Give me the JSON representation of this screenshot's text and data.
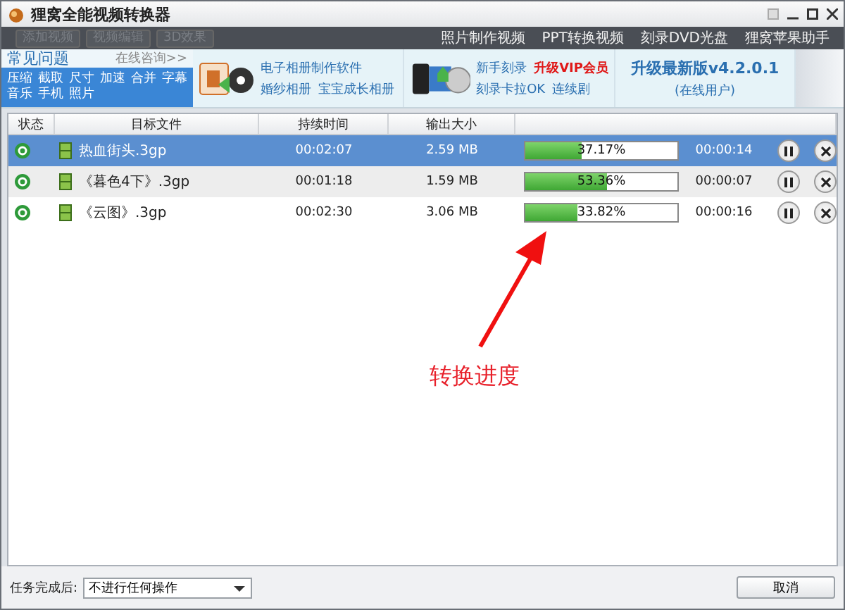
{
  "window": {
    "title": "狸窝全能视频转换器"
  },
  "toolbar": {
    "buttons": [
      {
        "label": "添加视频",
        "disabled": true
      },
      {
        "label": "视频编辑",
        "disabled": true
      },
      {
        "label": "3D效果",
        "disabled": true
      }
    ],
    "links": [
      "照片制作视频",
      "PPT转换视频",
      "刻录DVD光盘",
      "狸窝苹果助手"
    ]
  },
  "faq": {
    "title": "常见问题",
    "consult": "在线咨询>>",
    "tags": [
      "压缩",
      "截取",
      "尺寸",
      "加速",
      "合并",
      "字幕",
      "音乐",
      "手机",
      "照片"
    ]
  },
  "promos": [
    {
      "lines": [
        [
          "电子相册制作软件"
        ],
        [
          "婚纱相册",
          "宝宝成长相册"
        ]
      ]
    },
    {
      "lines": [
        [
          "新手刻录",
          "升级VIP会员"
        ],
        [
          "刻录卡拉OK",
          "连续剧"
        ]
      ]
    }
  ],
  "upgrade": {
    "title": "升级最新版v4.2.0.1",
    "subtitle": "(在线用户)"
  },
  "table": {
    "columns": [
      "状态",
      "目标文件",
      "持续时间",
      "输出大小"
    ],
    "rows": [
      {
        "selected": true,
        "file": "热血街头.3gp",
        "duration": "00:02:07",
        "size": "2.59 MB",
        "level": 0.3717,
        "percent": "37.17%",
        "remaining": "00:00:14"
      },
      {
        "selected": false,
        "file": "《暮色4下》.3gp",
        "duration": "00:01:18",
        "size": "1.59 MB",
        "level": 0.5336,
        "percent": "53.36%",
        "remaining": "00:00:07"
      },
      {
        "selected": false,
        "file": "《云图》.3gp",
        "duration": "00:02:30",
        "size": "3.06 MB",
        "level": 0.3382,
        "percent": "33.82%",
        "remaining": "00:00:16"
      }
    ]
  },
  "annotation": "转换进度",
  "footer": {
    "label": "任务完成后:",
    "select_value": "不进行任何操作",
    "cancel": "取消"
  }
}
